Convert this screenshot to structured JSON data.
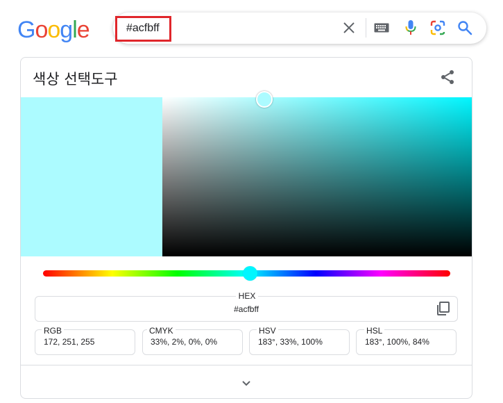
{
  "logo": {
    "letters": [
      {
        "ch": "G",
        "color": "#4285F4"
      },
      {
        "ch": "o",
        "color": "#EA4335"
      },
      {
        "ch": "o",
        "color": "#FBBC05"
      },
      {
        "ch": "g",
        "color": "#4285F4"
      },
      {
        "ch": "l",
        "color": "#34A853"
      },
      {
        "ch": "e",
        "color": "#EA4335"
      }
    ]
  },
  "search": {
    "query": "#acfbff",
    "icons": [
      "clear-icon",
      "keyboard-icon",
      "mic-icon",
      "lens-icon",
      "search-icon"
    ]
  },
  "color_picker": {
    "title": "색상 선택도구",
    "selected_color": "#acfbff",
    "hue_color": "#00f6ff",
    "hex": {
      "label": "HEX",
      "value": "#acfbff"
    },
    "fields": [
      {
        "label": "RGB",
        "value": "172, 251, 255"
      },
      {
        "label": "CMYK",
        "value": "33%, 2%, 0%, 0%"
      },
      {
        "label": "HSV",
        "value": "183°, 33%, 100%"
      },
      {
        "label": "HSL",
        "value": "183°, 100%, 84%"
      }
    ]
  },
  "colors": {
    "highlight_border": "#e0262b",
    "accent_blue": "#4285F4"
  }
}
